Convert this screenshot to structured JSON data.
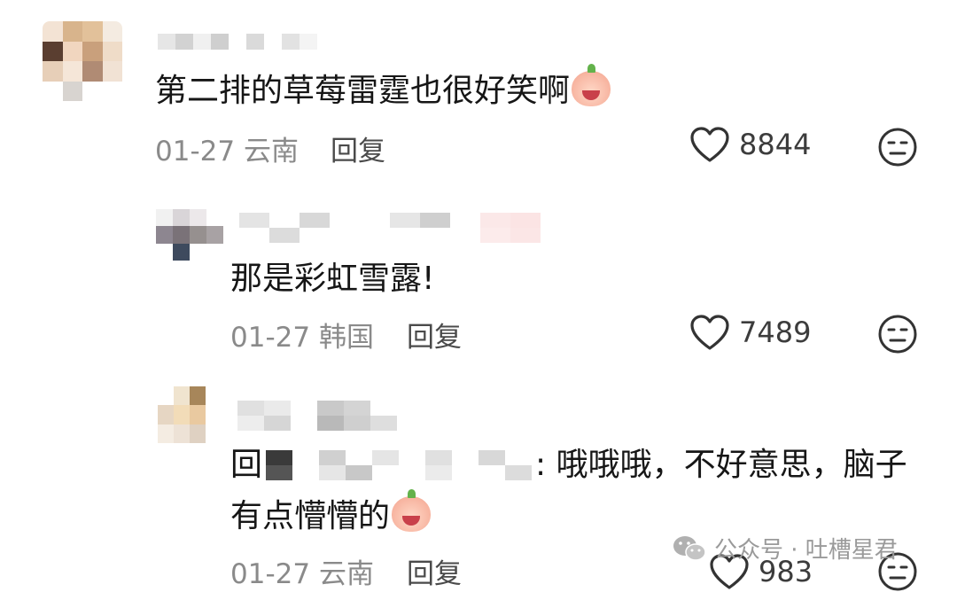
{
  "comments": [
    {
      "text": "第二排的草莓雷霆也很好笑啊",
      "date": "01-27",
      "location": "云南",
      "reply_label": "回复",
      "likes": "8844",
      "emoji": "laughing-crying-face"
    },
    {
      "text": "那是彩虹雪露!",
      "date": "01-27",
      "location": "韩国",
      "reply_label": "回复",
      "likes": "7489"
    },
    {
      "reply_prefix": "回",
      "text_line1": ": 哦哦哦，不好意思，脑子",
      "text_line2": "有点懵懵的",
      "date": "01-27",
      "location": "云南",
      "reply_label": "回复",
      "likes": "983",
      "emoji": "embarrassed-face"
    }
  ],
  "watermark": {
    "text": "公众号 · 吐槽星君",
    "icon": "wechat-icon"
  },
  "colors": {
    "meta_gray": "#8a8a8a",
    "text": "#161616",
    "watermark": "#9a9a9a"
  }
}
